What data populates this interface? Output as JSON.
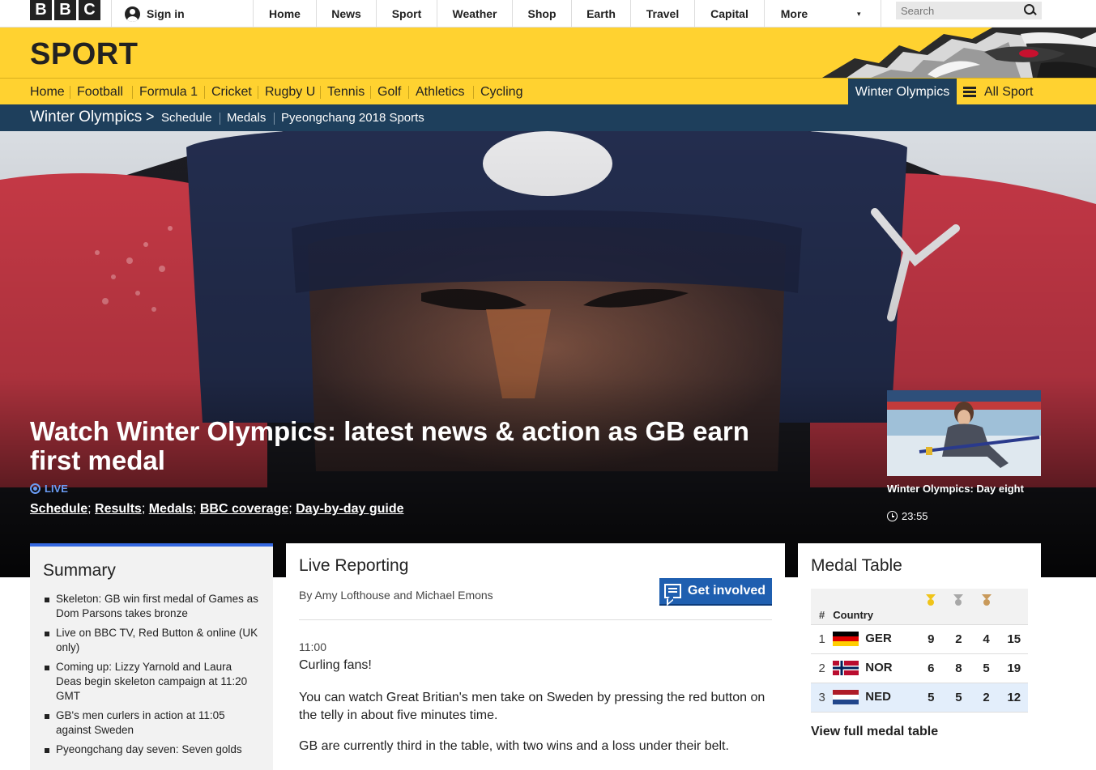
{
  "global": {
    "logo_letters": [
      "B",
      "B",
      "C"
    ],
    "signin": "Sign in",
    "nav": [
      "Home",
      "News",
      "Sport",
      "Weather",
      "Shop",
      "Earth",
      "Travel",
      "Capital",
      "More"
    ],
    "search_placeholder": "Search"
  },
  "sport": {
    "title": "SPORT",
    "nav": [
      "Home",
      "Football",
      "Formula 1",
      "Cricket",
      "Rugby U",
      "Tennis",
      "Golf",
      "Athletics",
      "Cycling"
    ],
    "active": "Winter Olympics",
    "all_sport": "All Sport"
  },
  "secondary": {
    "title": "Winter Olympics",
    "caret": ">",
    "links": [
      "Schedule",
      "Medals",
      "Pyeongchang 2018 Sports"
    ]
  },
  "hero": {
    "title": "Watch Winter Olympics: latest news & action as GB earn first medal",
    "live_label": "LIVE",
    "links": [
      "Schedule",
      "Results",
      "Medals",
      "BBC coverage",
      "Day-by-day guide"
    ],
    "thumb_title": "Winter Olympics: Day eight",
    "thumb_time": "23:55"
  },
  "summary": {
    "title": "Summary",
    "items": [
      "Skeleton: GB win first medal of Games as Dom Parsons takes bronze",
      "Live on BBC TV, Red Button & online (UK only)",
      "Coming up: Lizzy Yarnold and Laura Deas begin skeleton campaign at 11:20 GMT",
      "GB's men curlers in action at 11:05 against Sweden",
      "Pyeongchang day seven: Seven golds"
    ]
  },
  "live": {
    "title": "Live Reporting",
    "byline": "By Amy Lofthouse and Michael Emons",
    "get_involved": "Get involved",
    "time": "11:00",
    "headline": "Curling fans!",
    "p1": "You can watch Great Britian's men take on Sweden by pressing the red button on the telly in about five minutes time.",
    "p2": "GB are currently third in the table, with two wins and a loss under their belt."
  },
  "medals": {
    "title": "Medal Table",
    "col_rank": "#",
    "col_country": "Country",
    "rows": [
      {
        "rank": "1",
        "country": "GER",
        "gold": "9",
        "silver": "2",
        "bronze": "4",
        "total": "15"
      },
      {
        "rank": "2",
        "country": "NOR",
        "gold": "6",
        "silver": "8",
        "bronze": "5",
        "total": "19"
      },
      {
        "rank": "3",
        "country": "NED",
        "gold": "5",
        "silver": "5",
        "bronze": "2",
        "total": "12"
      }
    ],
    "view_full": "View full medal table"
  },
  "colors": {
    "sport_yellow": "#ffd230",
    "nav_blue": "#1e3f5c",
    "live_blue": "#6a9cf5",
    "button_blue": "#1f5fb0",
    "gold": "#f0c419",
    "silver": "#a8a8a8",
    "bronze": "#c99a5b"
  }
}
